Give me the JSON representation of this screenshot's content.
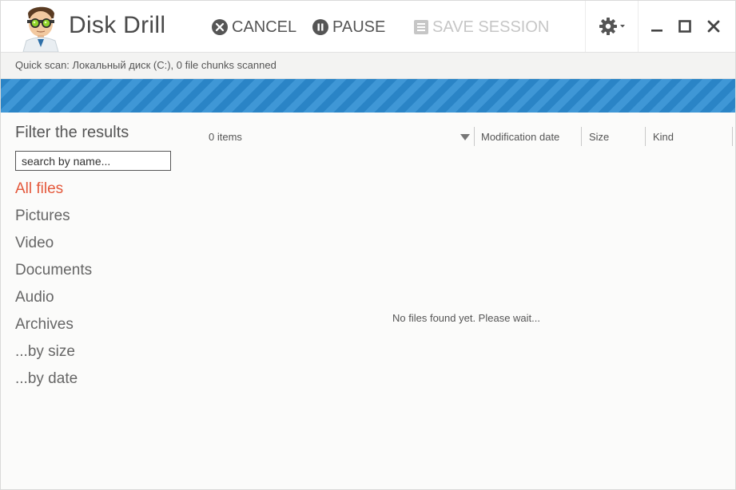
{
  "app": {
    "title": "Disk Drill"
  },
  "toolbar": {
    "cancel_label": "CANCEL",
    "pause_label": "PAUSE",
    "save_label": "SAVE SESSION"
  },
  "status": {
    "text": "Quick scan: Локальный диск (C:), 0 file chunks scanned"
  },
  "progress": {
    "fraction": 1.0,
    "color": "#2a84c6"
  },
  "sidebar": {
    "filter_title": "Filter the results",
    "search_placeholder": "search by name...",
    "items": [
      {
        "label": "All files",
        "active": true
      },
      {
        "label": "Pictures"
      },
      {
        "label": "Video"
      },
      {
        "label": "Documents"
      },
      {
        "label": "Audio"
      },
      {
        "label": "Archives"
      },
      {
        "label": "...by size"
      },
      {
        "label": "...by date"
      }
    ]
  },
  "list": {
    "items_count": "0 items",
    "columns": [
      "Modification date",
      "Size",
      "Kind"
    ],
    "empty_message": "No files found yet. Please wait..."
  },
  "colors": {
    "accent": "#e4583b",
    "progress_stripe": "#3f97d6"
  },
  "icons": [
    "close-circle-icon",
    "pause-circle-icon",
    "list-icon",
    "gear-icon",
    "minimize-icon",
    "maximize-icon",
    "close-icon",
    "sort-down-icon"
  ]
}
